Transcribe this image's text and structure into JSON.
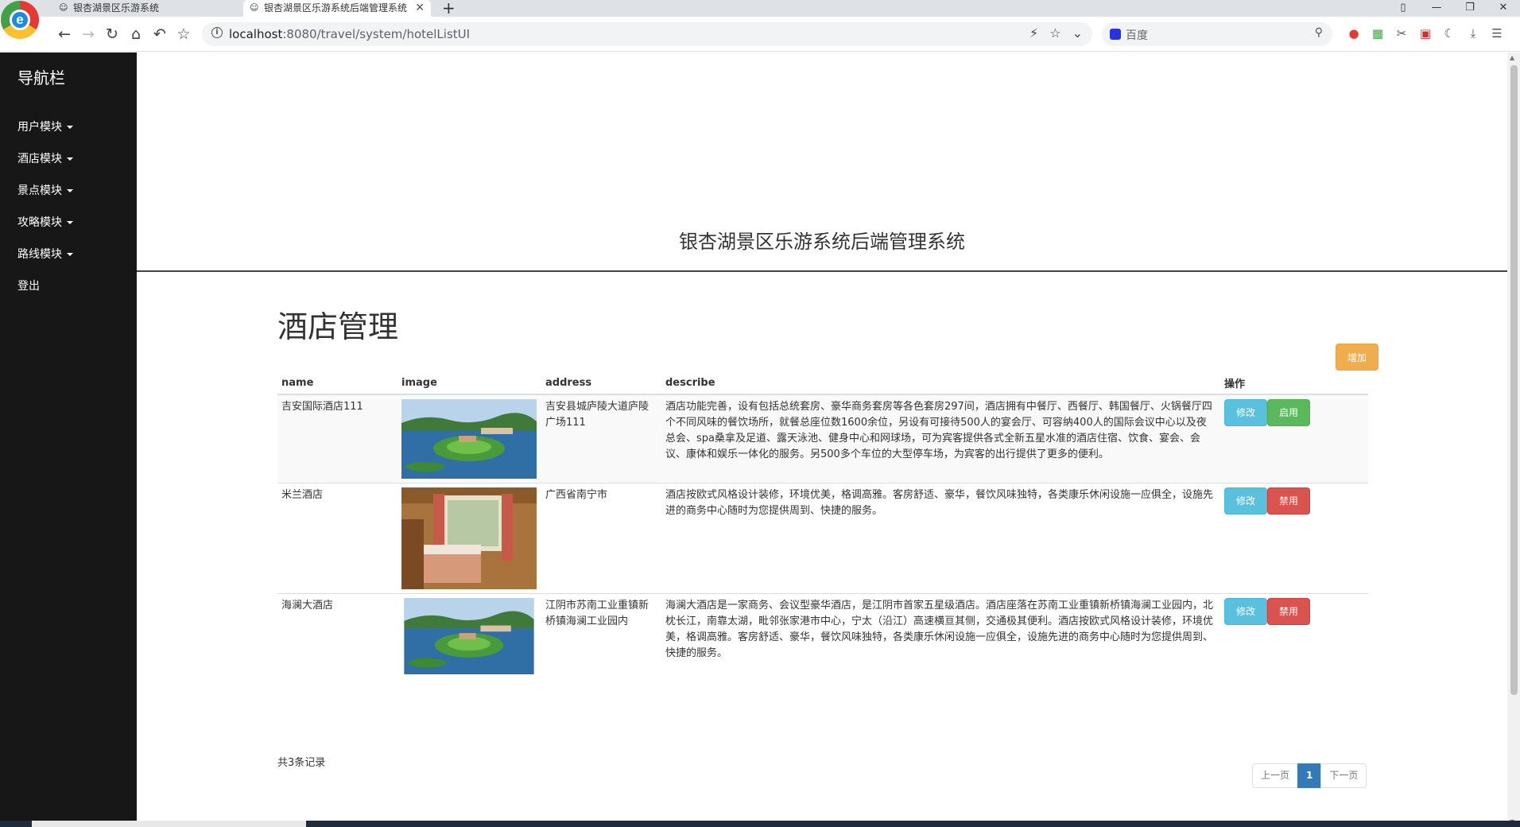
{
  "browser": {
    "tabs": [
      {
        "title": "银杏湖景区乐游系统",
        "active": false
      },
      {
        "title": "银杏湖景区乐游系统后端管理系统",
        "active": true
      }
    ],
    "url_host": "localhost",
    "url_path": ":8080/travel/system/hotelListUI",
    "search_placeholder": "百度"
  },
  "sidebar": {
    "brand": "导航栏",
    "items": [
      {
        "label": "用户模块",
        "dropdown": true
      },
      {
        "label": "酒店模块",
        "dropdown": true
      },
      {
        "label": "景点模块",
        "dropdown": true
      },
      {
        "label": "攻略模块",
        "dropdown": true
      },
      {
        "label": "路线模块",
        "dropdown": true
      },
      {
        "label": "登出",
        "dropdown": false
      }
    ]
  },
  "header": {
    "system_title": "银杏湖景区乐游系统后端管理系统"
  },
  "page": {
    "heading": "酒店管理",
    "add_label": "增加"
  },
  "table": {
    "columns": [
      "name",
      "image",
      "address",
      "describe",
      "操作"
    ],
    "rows": [
      {
        "name": "吉安国际酒店111",
        "image": "lake-island-photo",
        "address": "吉安县城庐陵大道庐陵广场111",
        "describe": "酒店功能完善，设有包括总统套房、豪华商务套房等各色套房297间，酒店拥有中餐厅、西餐厅、韩国餐厅、火锅餐厅四个不同风味的餐饮场所，就餐总座位数1600余位，另设有可接待500人的宴会厅、可容纳400人的国际会议中心以及夜总会、spa桑拿及足道、露天泳池、健身中心和网球场，可为宾客提供各式全新五星水准的酒店住宿、饮食、宴会、会议、康体和娱乐一体化的服务。另500多个车位的大型停车场，为宾客的出行提供了更多的便利。",
        "edit_label": "修改",
        "toggle_label": "启用"
      },
      {
        "name": "米兰酒店",
        "image": "hotel-room-photo",
        "address": "广西省南宁市",
        "describe": "酒店按欧式风格设计装修，环境优美，格调高雅。客房舒适、豪华，餐饮风味独特，各类康乐休闲设施一应俱全，设施先进的商务中心随时为您提供周到、快捷的服务。",
        "edit_label": "修改",
        "toggle_label": "禁用"
      },
      {
        "name": "海澜大酒店",
        "image": "lake-island-photo",
        "address": "江阴市苏南工业重镇新桥镇海澜工业园内",
        "describe": "海澜大酒店是一家商务、会议型豪华酒店，是江阴市首家五星级酒店。酒店座落在苏南工业重镇新桥镇海澜工业园内，北枕长江，南靠太湖，毗邻张家港市中心，宁太（沿江）高速横亘其侧，交通极其便利。酒店按欧式风格设计装修，环境优美，格调高雅。客房舒适、豪华，餐饮风味独特，各类康乐休闲设施一应俱全，设施先进的商务中心随时为您提供周到、快捷的服务。",
        "edit_label": "修改",
        "toggle_label": "禁用"
      }
    ]
  },
  "footer": {
    "record_count": "共3条记录",
    "pagination": {
      "prev": "上一页",
      "current": "1",
      "next": "下一页"
    }
  },
  "colors": {
    "sidebar_bg": "#171717",
    "warning": "#f0ad4e",
    "info": "#5bc0de",
    "success": "#5cb85c",
    "danger": "#d9534f",
    "primary": "#337ab7"
  }
}
